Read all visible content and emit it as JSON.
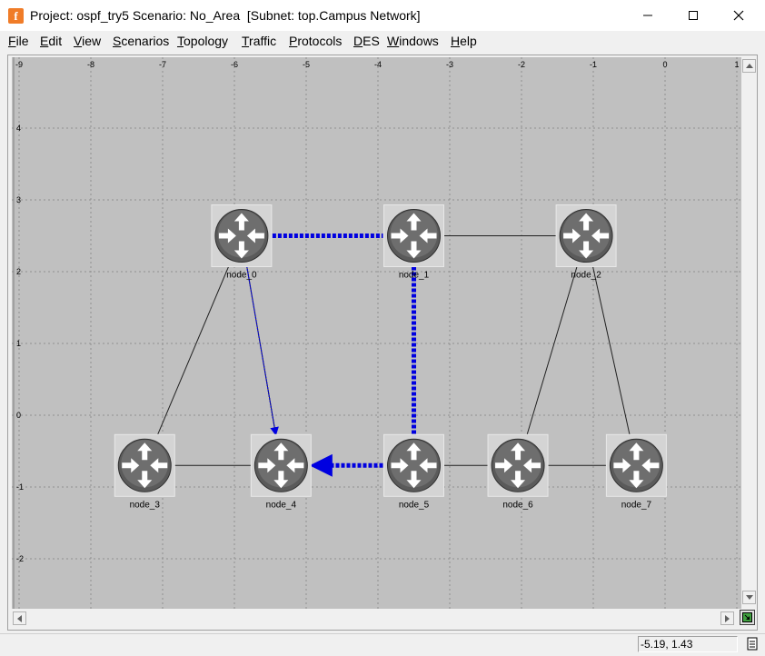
{
  "window": {
    "title": "Project: ospf_try5 Scenario: No_Area  [Subnet: top.Campus Network]",
    "app_icon_glyph": "f",
    "accent_color": "#f07c28"
  },
  "menu": [
    {
      "label": "File",
      "hotkey": "F",
      "rest": "ile"
    },
    {
      "label": "Edit",
      "hotkey": "E",
      "rest": "dit"
    },
    {
      "label": "View",
      "hotkey": "V",
      "rest": "iew"
    },
    {
      "label": "Scenarios",
      "hotkey": "S",
      "rest": "cenarios"
    },
    {
      "label": "Topology",
      "hotkey": "T",
      "rest": "opology"
    },
    {
      "label": "Traffic",
      "hotkey": "T",
      "rest": "raffic"
    },
    {
      "label": "Protocols",
      "hotkey": "P",
      "rest": "rotocols"
    },
    {
      "label": "DES",
      "hotkey": "D",
      "rest": "ES"
    },
    {
      "label": "Windows",
      "hotkey": "W",
      "rest": "indows"
    },
    {
      "label": "Help",
      "hotkey": "H",
      "rest": "elp"
    }
  ],
  "grid": {
    "x_ticks": [
      "-9",
      "-8",
      "-7",
      "-6",
      "-5",
      "-4",
      "-3",
      "-2",
      "-1",
      "0",
      "1"
    ],
    "y_ticks": [
      "4",
      "3",
      "2",
      "1",
      "0",
      "-1",
      "-2"
    ]
  },
  "nodes": [
    {
      "id": "node_0",
      "label": "node_0",
      "x": -5.9,
      "y": 2.5
    },
    {
      "id": "node_1",
      "label": "node_1",
      "x": -3.5,
      "y": 2.5
    },
    {
      "id": "node_2",
      "label": "node_2",
      "x": -1.1,
      "y": 2.5
    },
    {
      "id": "node_3",
      "label": "node_3",
      "x": -7.25,
      "y": -0.7
    },
    {
      "id": "node_4",
      "label": "node_4",
      "x": -5.35,
      "y": -0.7
    },
    {
      "id": "node_5",
      "label": "node_5",
      "x": -3.5,
      "y": -0.7
    },
    {
      "id": "node_6",
      "label": "node_6",
      "x": -2.05,
      "y": -0.7
    },
    {
      "id": "node_7",
      "label": "node_7",
      "x": -0.4,
      "y": -0.7
    }
  ],
  "links": [
    {
      "from": "node_0",
      "to": "node_3"
    },
    {
      "from": "node_0",
      "to": "node_4"
    },
    {
      "from": "node_1",
      "to": "node_2"
    },
    {
      "from": "node_2",
      "to": "node_6"
    },
    {
      "from": "node_2",
      "to": "node_7"
    },
    {
      "from": "node_3",
      "to": "node_4"
    },
    {
      "from": "node_5",
      "to": "node_6"
    },
    {
      "from": "node_6",
      "to": "node_7"
    }
  ],
  "routes": [
    {
      "points": [
        "node_0",
        "node_1"
      ],
      "style": "thick"
    },
    {
      "points": [
        "node_1",
        "node_5"
      ],
      "style": "thick"
    },
    {
      "points": [
        "node_5",
        "node_4"
      ],
      "style": "thick-arrow"
    },
    {
      "points": [
        "node_0",
        "node_4"
      ],
      "style": "thin-arrow"
    }
  ],
  "route_color": "#0000e0",
  "status": {
    "coordinates": "-5.19, 1.43"
  }
}
